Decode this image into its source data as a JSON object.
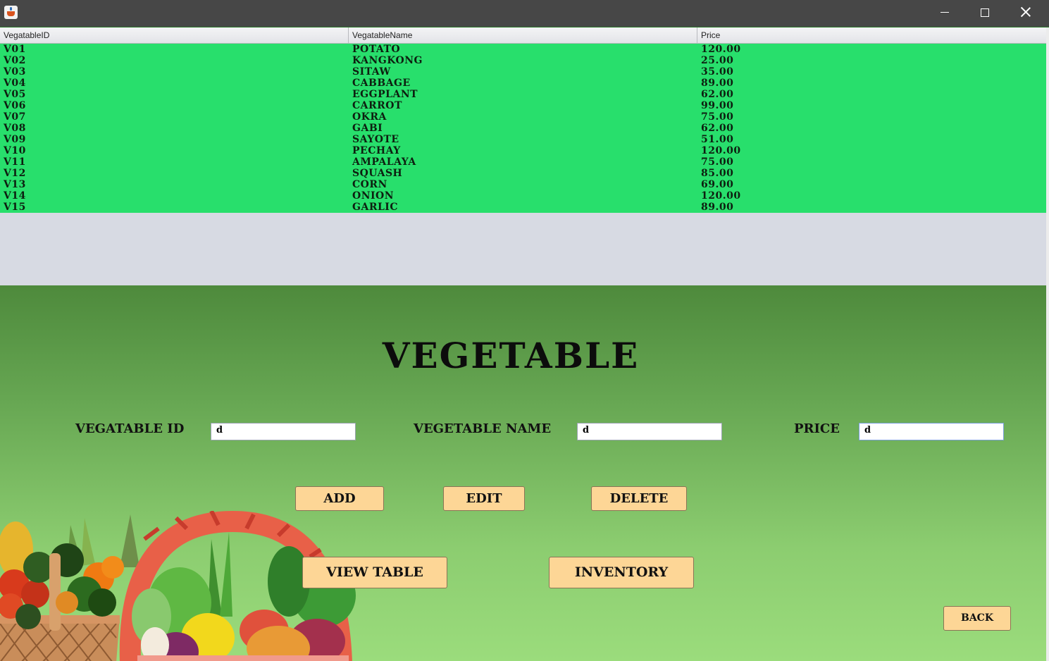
{
  "window": {
    "minimize_label": "",
    "maximize_label": "",
    "close_label": ""
  },
  "table": {
    "columns": [
      "VegatableID",
      "VegatableName",
      "Price"
    ],
    "rows": [
      [
        "V01",
        "POTATO",
        "120.00"
      ],
      [
        "V02",
        "KANGKONG",
        "25.00"
      ],
      [
        "V03",
        "SITAW",
        "35.00"
      ],
      [
        "V04",
        "CABBAGE",
        "89.00"
      ],
      [
        "V05",
        "EGGPLANT",
        "62.00"
      ],
      [
        "V06",
        "CARROT",
        "99.00"
      ],
      [
        "V07",
        "OKRA",
        "75.00"
      ],
      [
        "V08",
        "GABI",
        "62.00"
      ],
      [
        "V09",
        "SAYOTE",
        "51.00"
      ],
      [
        "V10",
        "PECHAY",
        "120.00"
      ],
      [
        "V11",
        "AMPALAYA",
        "75.00"
      ],
      [
        "V12",
        "SQUASH",
        "85.00"
      ],
      [
        "V13",
        "CORN",
        "69.00"
      ],
      [
        "V14",
        "ONION",
        "120.00"
      ],
      [
        "V15",
        "GARLIC",
        "89.00"
      ]
    ]
  },
  "form": {
    "title": "VEGETABLE",
    "id_label": "VEGATABLE ID",
    "id_value": "d",
    "name_label": "VEGETABLE NAME",
    "name_value": "d",
    "price_label": "PRICE",
    "price_value": "d"
  },
  "buttons": {
    "add": "ADD",
    "edit": "EDIT",
    "delete": "DELETE",
    "view_table": "VIEW TABLE",
    "inventory": "INVENTORY",
    "back": "BACK"
  },
  "colors": {
    "table_rows": "#28df6c",
    "button": "#fdd696",
    "title_bar": "#474747"
  }
}
